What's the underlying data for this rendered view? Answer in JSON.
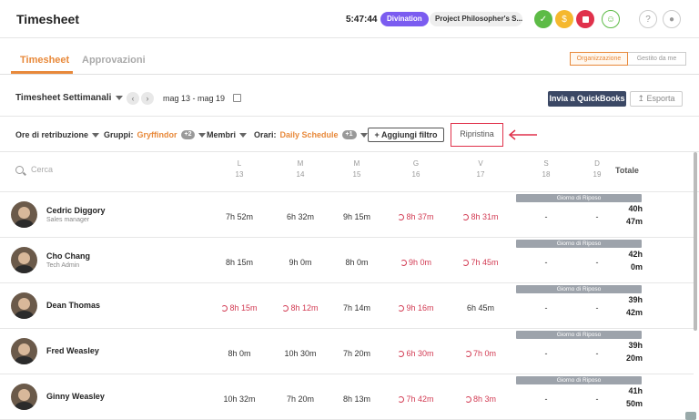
{
  "header": {
    "title": "Timesheet",
    "clock": "5:47:44",
    "task": "Divination",
    "project": "Project Philosopher's S...",
    "icons": [
      "tasks-icon",
      "coin-icon",
      "stop-icon",
      "user-icon",
      "help-icon",
      "team-icon"
    ]
  },
  "tabs": {
    "active": "Timesheet",
    "inactive": "Approvazioni"
  },
  "view_toggle": {
    "org": "Organizzazione",
    "managed": "Gestito da me"
  },
  "toolbar": {
    "period": "Timesheet Settimanali",
    "date_range": "mag 13 - mag 19",
    "quickbooks": "Invia a QuickBooks",
    "export": "Esporta"
  },
  "filters": {
    "pay_hours": "Ore di retribuzione",
    "groups_label": "Gruppi:",
    "groups_value": "Gryffindor",
    "groups_badge": "+2",
    "members": "Membri",
    "schedule_label": "Orari:",
    "schedule_value": "Daily Schedule",
    "schedule_badge": "+1",
    "add_filter": "Aggiungi filtro",
    "reset": "Ripristina"
  },
  "table": {
    "search_placeholder": "Cerca",
    "days": [
      {
        "letter": "L",
        "num": "13"
      },
      {
        "letter": "M",
        "num": "14"
      },
      {
        "letter": "M",
        "num": "15"
      },
      {
        "letter": "G",
        "num": "16"
      },
      {
        "letter": "V",
        "num": "17"
      },
      {
        "letter": "S",
        "num": "18"
      },
      {
        "letter": "D",
        "num": "19"
      }
    ],
    "total_label": "Totale",
    "rest_label": "Giorno di Riposo",
    "rows": [
      {
        "name": "Cedric Diggory",
        "role": "Sales manager",
        "cells": [
          "7h 52m",
          "6h 32m",
          "9h 15m",
          "8h 37m",
          "8h 31m",
          "-",
          "-"
        ],
        "total1": "40h",
        "total2": "47m"
      },
      {
        "name": "Cho Chang",
        "role": "Tech Admin",
        "cells": [
          "8h 15m",
          "9h 0m",
          "8h 0m",
          "9h 0m",
          "7h 45m",
          "-",
          "-"
        ],
        "total1": "42h",
        "total2": "0m"
      },
      {
        "name": "Dean Thomas",
        "role": "",
        "cells": [
          "8h 15m",
          "8h 12m",
          "7h 14m",
          "9h 16m",
          "6h 45m",
          "-",
          "-"
        ],
        "total1": "39h",
        "total2": "42m"
      },
      {
        "name": "Fred Weasley",
        "role": "",
        "cells": [
          "8h 0m",
          "10h 30m",
          "7h 20m",
          "6h 30m",
          "7h 0m",
          "-",
          "-"
        ],
        "total1": "39h",
        "total2": "20m"
      },
      {
        "name": "Ginny Weasley",
        "role": "",
        "cells": [
          "10h 32m",
          "7h 20m",
          "8h 13m",
          "7h 42m",
          "8h 3m",
          "-",
          "-"
        ],
        "total1": "41h",
        "total2": "50m"
      }
    ]
  }
}
